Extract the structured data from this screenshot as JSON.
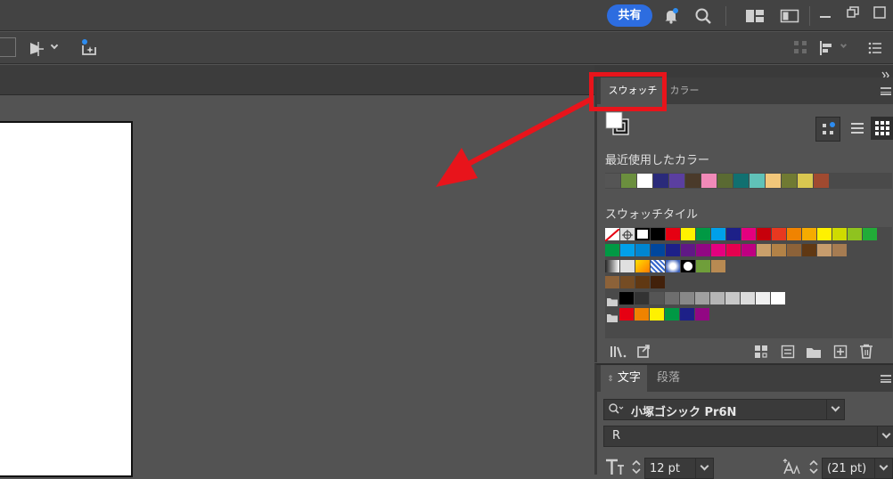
{
  "topbar": {
    "share_label": "共有"
  },
  "swatches_panel": {
    "tabs": [
      {
        "label": "スウォッチ",
        "active": true
      },
      {
        "label": "カラー",
        "active": false
      }
    ],
    "recent_colors_label": "最近使用したカラー",
    "recent_colors": [
      "#555555",
      "#6b8f3e",
      "#ffffff",
      "#2a2a7a",
      "#5b3fa0",
      "#4a3a2a",
      "#f18ab8",
      "#5a6a32",
      "#117070",
      "#60c2b8",
      "#f2c77a",
      "#707a33",
      "#d9c750",
      "#a04a30"
    ],
    "swatch_tile_label": "スウォッチタイル",
    "rows": [
      [
        "#ffffff",
        "#cccccc",
        "#ffffff",
        "#000000",
        "#e60012",
        "#fff100",
        "#009944",
        "#00a0e9",
        "#1d2088",
        "#e4007f",
        "#c7000b",
        "#e83820",
        "#f08300",
        "#f6ab00",
        "#fff100",
        "#cfdb00",
        "#8fc31f",
        "#22ac38"
      ],
      [
        "#009944",
        "#00a0e9",
        "#0086d1",
        "#00479d",
        "#1d2088",
        "#601986",
        "#920783",
        "#e4007f",
        "#e5004f",
        "#be0081",
        "#c9a06b",
        "#b28247",
        "#8c6239",
        "#603813",
        "#c69c6d",
        "#a67c52"
      ],
      [
        "#a0a0a0",
        "#e0e0e0",
        "#ffcc00",
        "#3366cc",
        "#8ab6e8",
        "#dddddd",
        "#6f9e3a",
        "#b88a52"
      ],
      [
        "#8c6239",
        "#754c24",
        "#603813",
        "#42210b"
      ],
      [
        "#000000",
        "#333333",
        "#555555",
        "#6e6e6e",
        "#888888",
        "#a0a0a0",
        "#b5b5b5",
        "#c8c8c8",
        "#dcdcdc",
        "#f0f0f0",
        "#ffffff"
      ],
      [
        "#e60012",
        "#f08300",
        "#fff100",
        "#009944",
        "#1d2088",
        "#920783"
      ]
    ]
  },
  "character_panel": {
    "tabs": [
      {
        "label": "文字",
        "active": true
      },
      {
        "label": "段落",
        "active": false
      }
    ],
    "font_family": "小塚ゴシック Pr6N",
    "font_style": "R",
    "font_size": "12 pt",
    "leading": "(21 pt)"
  },
  "colors": {
    "accent_blue": "#2d6de0",
    "annotation_red": "#e8141b"
  }
}
